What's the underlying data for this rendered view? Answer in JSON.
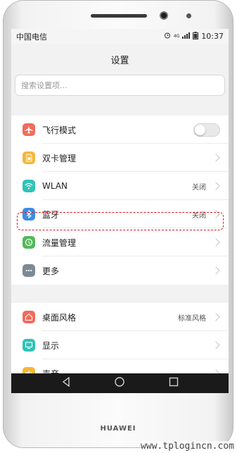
{
  "status_bar": {
    "carrier": "中国电信",
    "network": "4G",
    "time": "10:37"
  },
  "header": {
    "title": "设置"
  },
  "search": {
    "placeholder": "搜索设置项..."
  },
  "group1": [
    {
      "label": "飞行模式",
      "icon": "airplane-icon",
      "color": "#f26b5b",
      "control": "toggle",
      "value": ""
    },
    {
      "label": "双卡管理",
      "icon": "sim-card-icon",
      "color": "#f5b73c",
      "control": "chevron",
      "value": ""
    },
    {
      "label": "WLAN",
      "icon": "wifi-icon",
      "color": "#2ec4b6",
      "control": "chevron",
      "value": "关闭"
    },
    {
      "label": "蓝牙",
      "icon": "bluetooth-icon",
      "color": "#3a8ee6",
      "control": "chevron",
      "value": "关闭"
    },
    {
      "label": "流量管理",
      "icon": "data-usage-icon",
      "color": "#53b95a",
      "control": "chevron",
      "value": ""
    },
    {
      "label": "更多",
      "icon": "more-icon",
      "color": "#7d8a96",
      "control": "chevron",
      "value": ""
    }
  ],
  "group2": [
    {
      "label": "桌面风格",
      "icon": "home-style-icon",
      "color": "#f26b5b",
      "control": "chevron",
      "value": "标准风格"
    },
    {
      "label": "显示",
      "icon": "display-icon",
      "color": "#2ec4b6",
      "control": "chevron",
      "value": ""
    },
    {
      "label": "声音",
      "icon": "sound-icon",
      "color": "#f5b73c",
      "control": "chevron",
      "value": ""
    }
  ],
  "brand": "HUAWEI",
  "watermark": "www.tplogincn.com"
}
